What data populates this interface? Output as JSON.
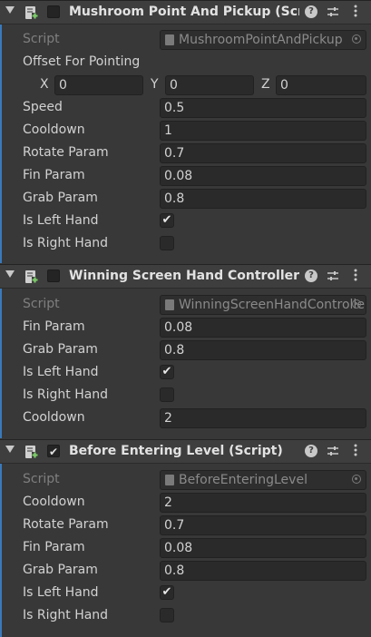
{
  "components": [
    {
      "title": "Mushroom Point And Pickup (Script)",
      "enabled": false,
      "script": "MushroomPointAndPickup",
      "script_label": "Script",
      "offset_label": "Offset For Pointing",
      "vector": {
        "x_label": "X",
        "x": "0",
        "y_label": "Y",
        "y": "0",
        "z_label": "Z",
        "z": "0"
      },
      "fields": [
        {
          "label": "Speed",
          "value": "0.5"
        },
        {
          "label": "Cooldown",
          "value": "1"
        },
        {
          "label": "Rotate Param",
          "value": "0.7"
        },
        {
          "label": "Fin Param",
          "value": "0.08"
        },
        {
          "label": "Grab Param",
          "value": "0.8"
        }
      ],
      "toggles": [
        {
          "label": "Is Left Hand",
          "checked": true
        },
        {
          "label": "Is Right Hand",
          "checked": false
        }
      ]
    },
    {
      "title": "Winning Screen Hand Controller Script",
      "enabled": false,
      "script": "WinningScreenHandController",
      "script_label": "Script",
      "fields_a": [
        {
          "label": "Fin Param",
          "value": "0.08"
        },
        {
          "label": "Grab Param",
          "value": "0.8"
        }
      ],
      "toggles": [
        {
          "label": "Is Left Hand",
          "checked": true
        },
        {
          "label": "Is Right Hand",
          "checked": false
        }
      ],
      "fields_b": [
        {
          "label": "Cooldown",
          "value": "2"
        }
      ]
    },
    {
      "title": "Before Entering Level (Script)",
      "enabled": true,
      "script": "BeforeEnteringLevel",
      "script_label": "Script",
      "fields": [
        {
          "label": "Cooldown",
          "value": "2"
        },
        {
          "label": "Rotate Param",
          "value": "0.7"
        },
        {
          "label": "Fin Param",
          "value": "0.08"
        },
        {
          "label": "Grab Param",
          "value": "0.8"
        }
      ],
      "toggles": [
        {
          "label": "Is Left Hand",
          "checked": true
        },
        {
          "label": "Is Right Hand",
          "checked": false
        }
      ]
    }
  ],
  "check_glyph": "✔",
  "help_glyph": "?",
  "colors": {
    "accent_bar": "#3a79bb",
    "background": "#383838",
    "header": "#3e3e3e"
  }
}
